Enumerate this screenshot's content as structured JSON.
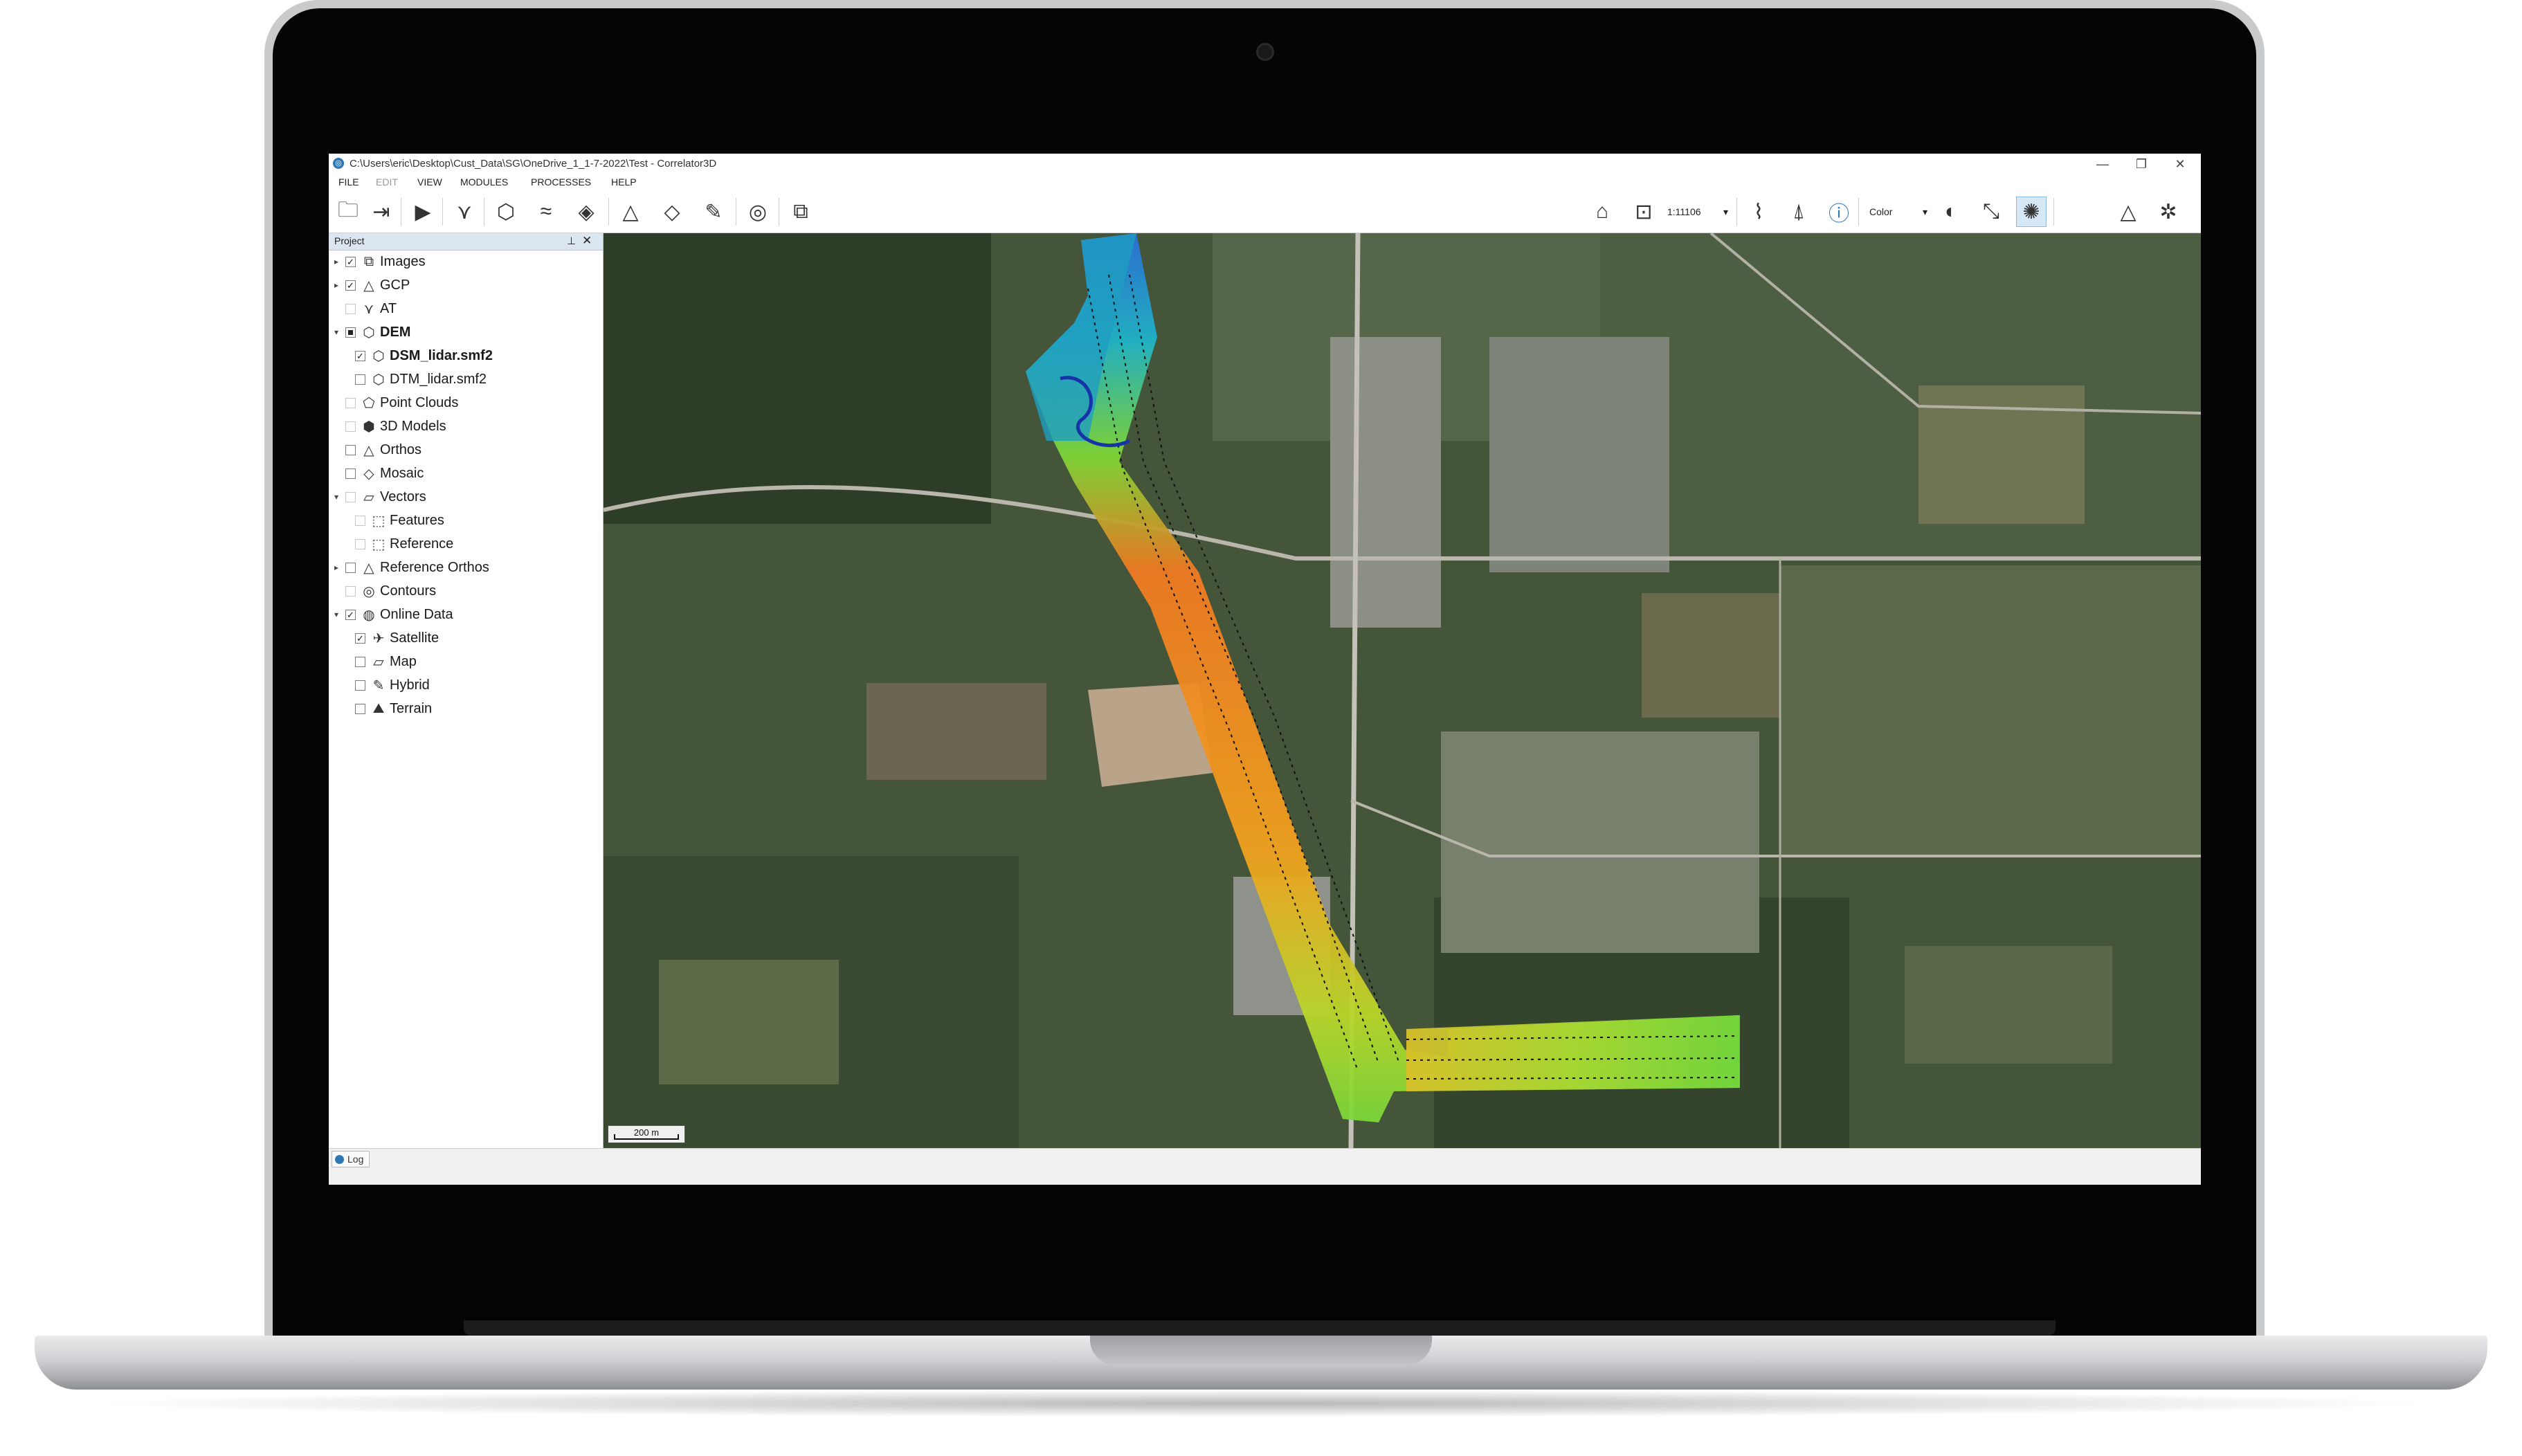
{
  "window": {
    "title": "C:\\Users\\eric\\Desktop\\Cust_Data\\SG\\OneDrive_1_1-7-2022\\Test - Correlator3D",
    "app_icon": "correlator3d-icon",
    "controls": {
      "minimize": "—",
      "maximize": "❐",
      "close": "✕"
    }
  },
  "menu": [
    "FILE",
    "EDIT",
    "VIEW",
    "MODULES",
    "PROCESSES",
    "HELP"
  ],
  "toolbar": {
    "scale_value": "1:11106",
    "color_mode": "Color",
    "dropdown_arrow": "▾"
  },
  "panel": {
    "title": "Project",
    "pin": "⊥",
    "close": "✕"
  },
  "tree": [
    {
      "label": "Images"
    },
    {
      "label": "GCP"
    },
    {
      "label": "AT"
    },
    {
      "label": "DEM"
    },
    {
      "label": "DSM_lidar.smf2"
    },
    {
      "label": "DTM_lidar.smf2"
    },
    {
      "label": "Point Clouds"
    },
    {
      "label": "3D Models"
    },
    {
      "label": "Orthos"
    },
    {
      "label": "Mosaic"
    },
    {
      "label": "Vectors"
    },
    {
      "label": "Features"
    },
    {
      "label": "Reference"
    },
    {
      "label": "Reference Orthos"
    },
    {
      "label": "Contours"
    },
    {
      "label": "Online Data"
    },
    {
      "label": "Satellite"
    },
    {
      "label": "Map"
    },
    {
      "label": "Hybrid"
    },
    {
      "label": "Terrain"
    }
  ],
  "checks": {
    "checked": "✓"
  },
  "map": {
    "scale_label": "200 m"
  },
  "statusbar": {
    "log_tab": "Log"
  },
  "colors": {
    "panel_header": "#dce6f1",
    "accent": "#2f77b5",
    "dem_low": "#2a6fd6",
    "dem_mid": "#8fdc2a",
    "dem_high": "#e8491c"
  }
}
